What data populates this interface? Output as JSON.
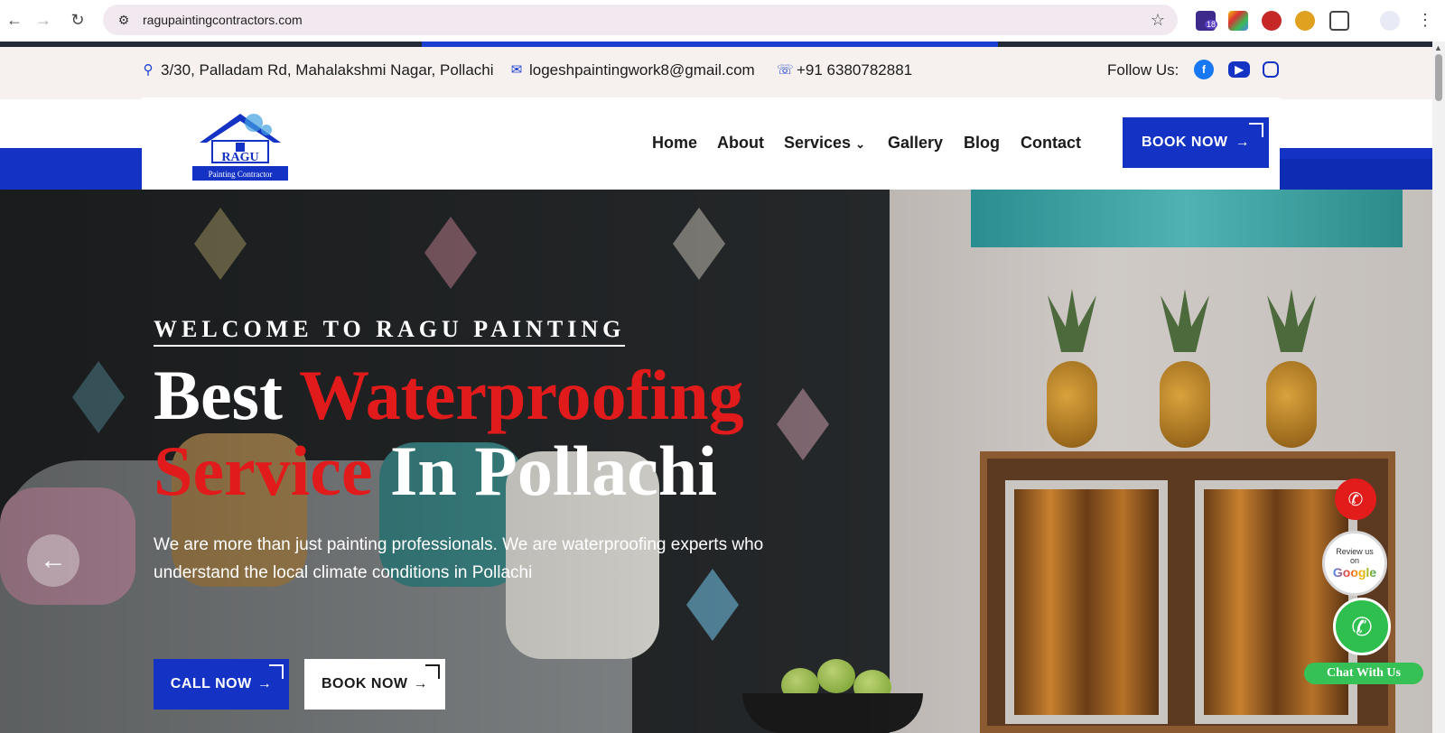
{
  "browser": {
    "url": "ragupaintingcontractors.com",
    "ext_badge": "18"
  },
  "topbar": {
    "address": "3/30, Palladam Rd, Mahalakshmi Nagar, Pollachi",
    "email": "logeshpaintingwork8@gmail.com",
    "phone": "+91 6380782881",
    "follow_label": "Follow Us:"
  },
  "header": {
    "logo_title": "RAGU",
    "logo_subtitle": "Painting Contractor",
    "menu": [
      "Home",
      "About",
      "Services",
      "Gallery",
      "Blog",
      "Contact"
    ],
    "book_label": "BOOK NOW"
  },
  "hero": {
    "welcome": "WELCOME TO RAGU PAINTING",
    "title_part1": "Best ",
    "title_red1": "Waterproofing",
    "title_red2": "Service",
    "title_part2": " In Pollachi",
    "description": "We are more than just painting professionals. We are waterproofing experts who understand the local climate conditions in Pollachi",
    "call_label": "CALL NOW",
    "book_label": "BOOK NOW"
  },
  "floating": {
    "google_line1": "Review us",
    "google_line2": "on",
    "google_brand": "Google",
    "chat_label": "Chat With Us"
  },
  "colors": {
    "brand_blue": "#1432c4",
    "accent_red": "#e11b1b",
    "whatsapp_green": "#35c155"
  }
}
